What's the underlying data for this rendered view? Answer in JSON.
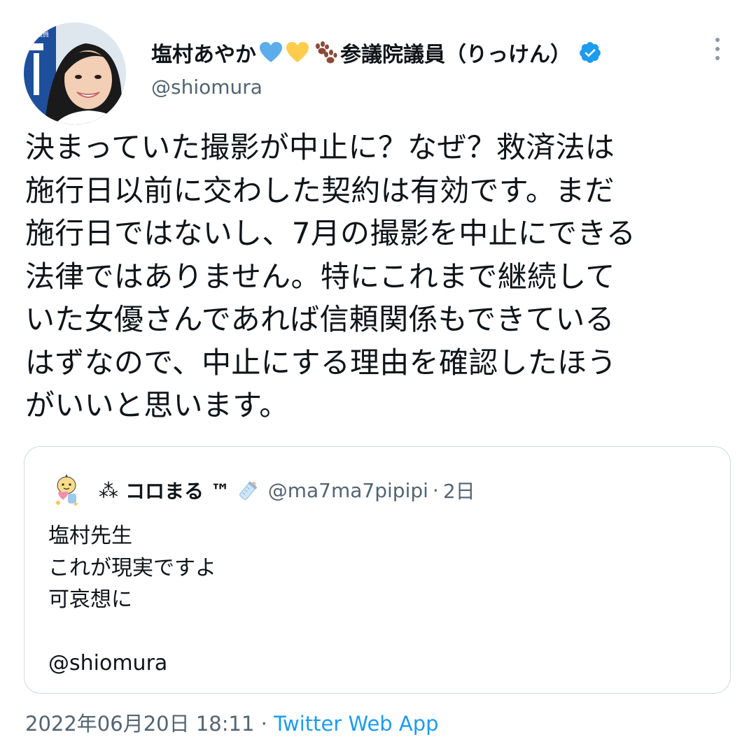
{
  "author": {
    "display_name": "塩村あやか",
    "name_emojis": [
      "blue-heart-icon",
      "yellow-heart-icon",
      "paw-prints-icon"
    ],
    "title_suffix": "参議院議員（りっけん）",
    "handle": "@shiomura",
    "verified": true,
    "avatar_poster_text": "議員"
  },
  "tweet": {
    "text": "決まっていた撮影が中止に？なぜ？救済法は\n施行日以前に交わした契約は有効です。まだ\n施行日ではないし、7月の撮影を中止にできる\n法律ではありません。特にこれまで継続して\nいた女優さんであれば信頼関係もできている\nはずなので、中止にする理由を確認したほう\nがいいと思います。"
  },
  "quoted_tweet": {
    "name_prefix": "⁂",
    "display_name": "コロまる ™",
    "name_emoji": "baby-bottle-icon",
    "handle": "@ma7ma7pipipi",
    "separator": "·",
    "time": "2日",
    "text": "塩村先生\nこれが現実ですよ\n可哀想に\n\n@shiomura"
  },
  "meta": {
    "timestamp": "2022年06月20日 18:11",
    "separator": "·",
    "source": "Twitter Web App"
  },
  "colors": {
    "verified_blue": "#1d9bf0",
    "secondary_text": "#536471",
    "border": "#cfd9de",
    "link": "#1d9bf0"
  }
}
